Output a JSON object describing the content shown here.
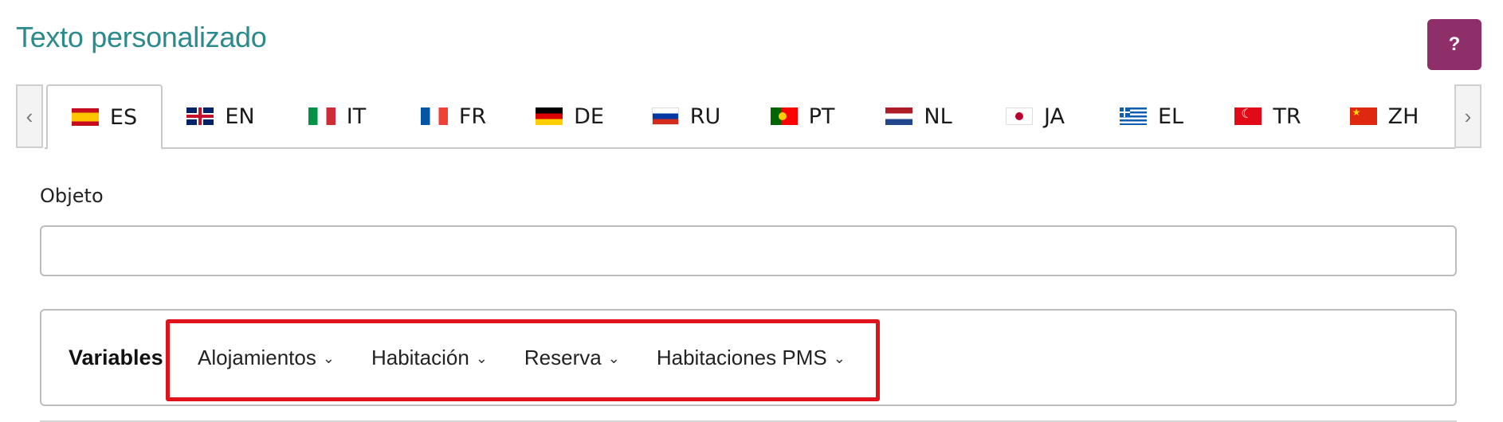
{
  "header": {
    "title": "Texto personalizado",
    "help_label": "?"
  },
  "language_tabs": {
    "scroll_left": "‹",
    "scroll_right": "›",
    "active": "ES",
    "items": [
      {
        "code": "ES",
        "flag": "spain-flag-icon"
      },
      {
        "code": "EN",
        "flag": "uk-flag-icon"
      },
      {
        "code": "IT",
        "flag": "italy-flag-icon"
      },
      {
        "code": "FR",
        "flag": "france-flag-icon"
      },
      {
        "code": "DE",
        "flag": "germany-flag-icon"
      },
      {
        "code": "RU",
        "flag": "russia-flag-icon"
      },
      {
        "code": "PT",
        "flag": "portugal-flag-icon"
      },
      {
        "code": "NL",
        "flag": "netherlands-flag-icon"
      },
      {
        "code": "JA",
        "flag": "japan-flag-icon"
      },
      {
        "code": "EL",
        "flag": "greece-flag-icon"
      },
      {
        "code": "TR",
        "flag": "turkey-flag-icon"
      },
      {
        "code": "ZH",
        "flag": "china-flag-icon"
      }
    ]
  },
  "form": {
    "subject_label": "Objeto",
    "subject_value": "",
    "subject_placeholder": ""
  },
  "variables": {
    "label": "Variables",
    "menus": [
      {
        "label": "Alojamientos",
        "icon": "chevron-down-icon"
      },
      {
        "label": "Habitación",
        "icon": "chevron-down-icon"
      },
      {
        "label": "Reserva",
        "icon": "chevron-down-icon"
      },
      {
        "label": "Habitaciones PMS",
        "icon": "chevron-down-icon"
      }
    ]
  },
  "colors": {
    "title": "#2a8a8c",
    "help_button": "#8f2f69",
    "highlight_border": "#e0121b"
  }
}
